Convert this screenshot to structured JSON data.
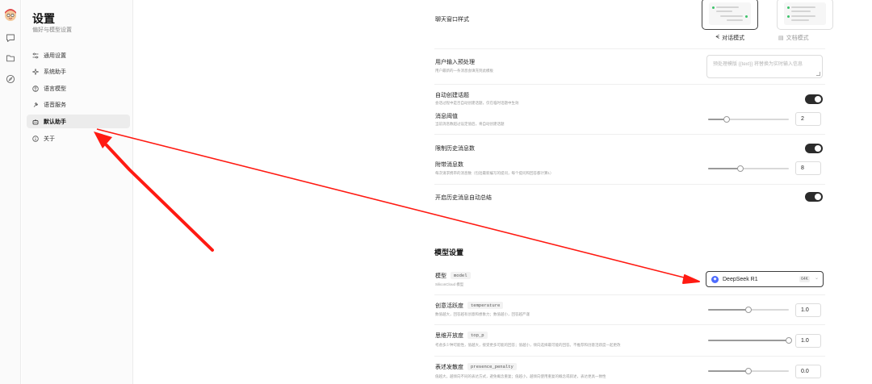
{
  "settings": {
    "title": "设置",
    "subtitle": "偏好与模型设置"
  },
  "nav": [
    {
      "label": "通用设置",
      "icon": "sliders-icon"
    },
    {
      "label": "系统助手",
      "icon": "sparkle-icon"
    },
    {
      "label": "语言模型",
      "icon": "brain-icon"
    },
    {
      "label": "语音服务",
      "icon": "mic-icon"
    },
    {
      "label": "默认助手",
      "icon": "bot-icon"
    },
    {
      "label": "关于",
      "icon": "info-icon"
    }
  ],
  "chat_style": {
    "title": "聊天窗口样式",
    "options": [
      {
        "label": "对话模式",
        "selected": true
      },
      {
        "label": "文档模式",
        "selected": false
      }
    ]
  },
  "input_preprocess": {
    "title": "用户输入预处理",
    "desc": "用户最新的一条消息会填充到此模板",
    "placeholder": "预处理模版 {{text}} 将替换为实时输入信息"
  },
  "auto_topic": {
    "title": "自动创建话题",
    "desc": "会话过程中是否自动创建话题，仅在临时话题中生效",
    "on": true
  },
  "msg_threshold": {
    "title": "消息阈值",
    "desc": "当前消息数超过设定值后，将自动创建话题",
    "value": "2",
    "level": 0.23
  },
  "limit_history": {
    "title": "限制历史消息数",
    "on": true
  },
  "attached_count": {
    "title": "附带消息数",
    "desc": "每次请求携带的消息数（包括最新编写的提问，每个提问和回答都计算1）",
    "value": "8",
    "level": 0.4
  },
  "auto_summary": {
    "title": "开启历史消息自动总结",
    "on": true
  },
  "model_section": {
    "title": "模型设置",
    "model": {
      "title": "模型",
      "code": "model",
      "desc": "SiliconCloud 模型",
      "selected": "DeepSeek R1",
      "context": "64K",
      "provider_icon": "deepseek-logo-icon"
    },
    "temperature": {
      "title": "创意活跃度",
      "code": "temperature",
      "desc": "数值越大，回答越有创意和想象力；数值越小，回答越严谨",
      "value": "1.0",
      "level": 0.5
    },
    "top_p": {
      "title": "思维开放度",
      "code": "top_p",
      "desc": "考虑多少种可能性，值越大，接受更多可能的回答；值越小，倾向选择最可能的回答。不推荐和创意活跃度一起更改",
      "value": "1.0",
      "level": 1.0
    },
    "presence_penalty": {
      "title": "表述发散度",
      "code": "presence_penalty",
      "desc": "值越大，越倾向不同的表达方式，避免概念重复；值越小，越倾向使用重复的概念或叙述，表达更具一致性",
      "value": "0.0",
      "level": 0.5
    }
  },
  "colors": {
    "accent_dark": "#2b2b2b",
    "annotation_arrow": "#ff1a12",
    "deepseek_blue": "#4d6bfe"
  }
}
